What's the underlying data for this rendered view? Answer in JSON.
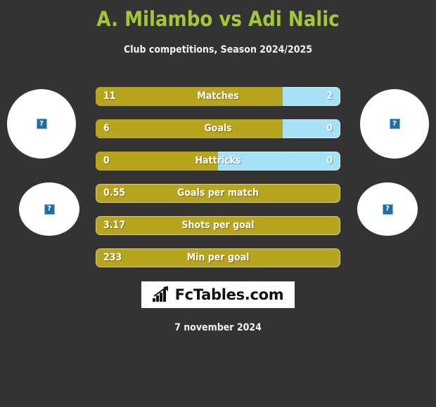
{
  "header": {
    "title": "A. Milambo vs Adi Nalic",
    "subtitle": "Club competitions, Season 2024/2025",
    "title_color": "#a4c639"
  },
  "colors": {
    "background": "#333333",
    "left_player_bar": "#b8a51e",
    "right_player_bar": "#a5e2f7",
    "text": "#ffffff"
  },
  "avatars": {
    "left_top": {
      "alt": "broken-image-placeholder",
      "glyph": "?"
    },
    "right_top": {
      "alt": "broken-image-placeholder",
      "glyph": "?"
    },
    "left_bottom": {
      "alt": "broken-image-placeholder",
      "glyph": "?"
    },
    "right_bottom": {
      "alt": "broken-image-placeholder",
      "glyph": "?"
    }
  },
  "stats": [
    {
      "label": "Matches",
      "left": "11",
      "right": "2",
      "left_pct": 76.5,
      "split": true
    },
    {
      "label": "Goals",
      "left": "6",
      "right": "0",
      "left_pct": 76.5,
      "split": true
    },
    {
      "label": "Hattricks",
      "left": "0",
      "right": "0",
      "left_pct": 50.0,
      "split": true
    },
    {
      "label": "Goals per match",
      "left": "0.55",
      "right": "",
      "left_pct": 100,
      "split": false
    },
    {
      "label": "Shots per goal",
      "left": "3.17",
      "right": "",
      "left_pct": 100,
      "split": false
    },
    {
      "label": "Min per goal",
      "left": "233",
      "right": "",
      "left_pct": 100,
      "split": false
    }
  ],
  "footer": {
    "logo_text": "FcTables.com",
    "logo_icon": "bar-chart-arrow-icon",
    "date": "7 november 2024"
  },
  "chart_data": {
    "type": "bar",
    "title": "A. Milambo vs Adi Nalic",
    "subtitle": "Club competitions, Season 2024/2025",
    "categories": [
      "Matches",
      "Goals",
      "Hattricks",
      "Goals per match",
      "Shots per goal",
      "Min per goal"
    ],
    "series": [
      {
        "name": "A. Milambo",
        "values": [
          11,
          6,
          0,
          0.55,
          3.17,
          233
        ]
      },
      {
        "name": "Adi Nalic",
        "values": [
          2,
          0,
          0,
          null,
          null,
          null
        ]
      }
    ],
    "legend": "none",
    "grid": false,
    "orientation": "horizontal-diverging"
  }
}
